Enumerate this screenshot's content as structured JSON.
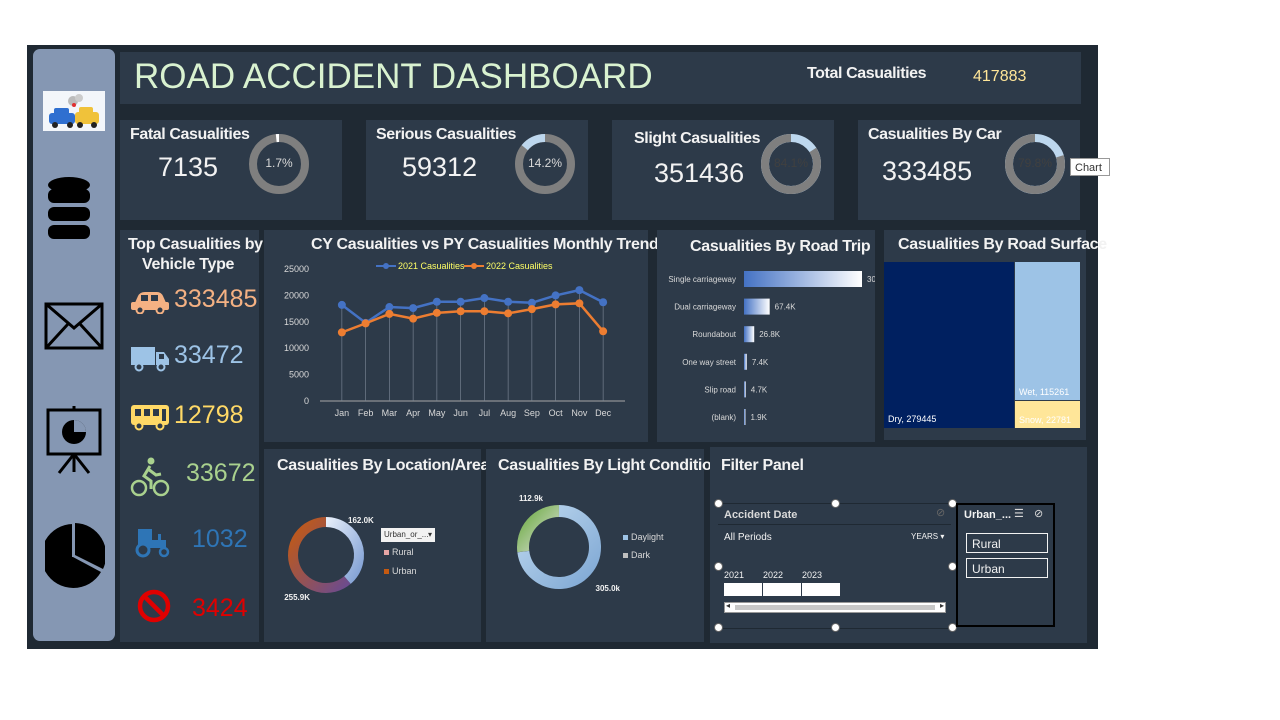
{
  "header": {
    "title": "ROAD ACCIDENT DASHBOARD",
    "total_label": "Total Casualities",
    "total_value": "417883"
  },
  "sidebar": {
    "icons": [
      "accident-image",
      "database-icon",
      "mail-icon",
      "presentation-icon",
      "pie-chart-icon"
    ]
  },
  "kpis": [
    {
      "title": "Fatal Casualities",
      "value": "7135",
      "pct_label": "1.7%",
      "pct": 0.017
    },
    {
      "title": "Serious Casualities",
      "value": "59312",
      "pct_label": "14.2%",
      "pct": 0.142
    },
    {
      "title": "Slight Casualities",
      "value": "351436",
      "pct_label": "84.1%",
      "pct": 0.841
    },
    {
      "title": "Casualities By Car",
      "value": "333485",
      "pct_label": "79.8%",
      "pct": 0.798
    }
  ],
  "tooltip": "Chart",
  "vehicle": {
    "title_line1": "Top Casualities by",
    "title_line2": "Vehicle Type",
    "items": [
      {
        "icon": "car-icon",
        "value": "333485",
        "color": "#f4b183"
      },
      {
        "icon": "truck-icon",
        "value": "33472",
        "color": "#9dc3e6"
      },
      {
        "icon": "bus-icon",
        "value": "12798",
        "color": "#ffd966"
      },
      {
        "icon": "bicycle-icon",
        "value": "33672",
        "color": "#a9d18e"
      },
      {
        "icon": "tractor-icon",
        "value": "1032",
        "color": "#2e75b6"
      },
      {
        "icon": "prohibited-icon",
        "value": "3424",
        "color": "#e00000"
      }
    ]
  },
  "trend": {
    "title": "CY Casualities vs PY Casualities Monthly Trend",
    "chart_data": {
      "type": "line",
      "categories": [
        "Jan",
        "Feb",
        "Mar",
        "Apr",
        "May",
        "Jun",
        "Jul",
        "Aug",
        "Sep",
        "Oct",
        "Nov",
        "Dec"
      ],
      "series": [
        {
          "name": "2021 Casualities",
          "color": "#4472c4",
          "values": [
            18200,
            14800,
            17800,
            17600,
            18800,
            18800,
            19500,
            18800,
            18600,
            20000,
            21000,
            18700
          ]
        },
        {
          "name": "2022 Casualities",
          "color": "#ed7d31",
          "values": [
            13000,
            14700,
            16500,
            15600,
            16700,
            17000,
            17000,
            16600,
            17400,
            18300,
            18500,
            13200
          ]
        }
      ],
      "ylim": [
        0,
        25000
      ],
      "yticks": [
        "25000",
        "20000",
        "15000",
        "10000",
        "5000",
        "0"
      ]
    }
  },
  "road_trip": {
    "title": "Casualities By Road Trip",
    "chart_data": {
      "type": "bar",
      "categories": [
        "Single carriageway",
        "Dual carriageway",
        "Roundabout",
        "One way street",
        "Slip road",
        "(blank)"
      ],
      "values": [
        309.7,
        67.4,
        26.8,
        7.4,
        4.7,
        1.9
      ],
      "labels": [
        "309.7K",
        "67.4K",
        "26.8K",
        "7.4K",
        "4.7K",
        "1.9K"
      ]
    }
  },
  "road_surface": {
    "title": "Casualities By Road Surface",
    "chart_data": {
      "type": "treemap",
      "items": [
        {
          "label": "Dry, 279445",
          "value": 279445,
          "color": "#002060"
        },
        {
          "label": "Wet, 115261",
          "value": 115261,
          "color": "#9dc3e6"
        },
        {
          "label": "Snow, 22781",
          "value": 22781,
          "color": "#ffe699"
        }
      ]
    }
  },
  "location": {
    "title": "Casualities By Location/Area",
    "dropdown": "Urban_or_...",
    "chart_data": {
      "type": "pie",
      "categories": [
        "Rural",
        "Urban"
      ],
      "values": [
        162.0,
        255.9
      ],
      "labels": [
        "162.0K",
        "255.9K"
      ],
      "colors": [
        "#b4c7e7",
        "#c55a11"
      ]
    }
  },
  "light": {
    "title": "Casualities By Light Condition",
    "chart_data": {
      "type": "pie",
      "categories": [
        "Daylight",
        "Dark"
      ],
      "values": [
        305.0,
        112.9
      ],
      "labels": [
        "305.0k",
        "112.9k"
      ],
      "colors": [
        "#9dc3e6",
        "#70ad47"
      ]
    }
  },
  "filter": {
    "title": "Filter Panel",
    "timeline": {
      "title": "Accident Date",
      "periods": "All Periods",
      "level": "YEARS",
      "years": [
        "2021",
        "2022",
        "2023"
      ]
    },
    "slicer": {
      "title": "Urban_...",
      "items": [
        "Rural",
        "Urban"
      ]
    }
  }
}
